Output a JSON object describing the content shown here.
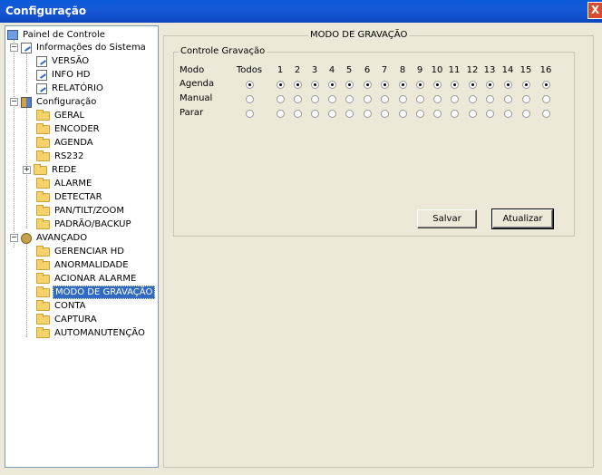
{
  "window": {
    "title": "Configuração",
    "close_label": "X"
  },
  "tree": {
    "root": "Painel de Controle",
    "info_sistema": "Informações do Sistema",
    "versao": "VERSÃO",
    "info_hd": "INFO HD",
    "relatorio": "RELATÓRIO",
    "configuracao": "Configuração",
    "geral": "GERAL",
    "encoder": "ENCODER",
    "agenda": "AGENDA",
    "rs232": "RS232",
    "rede": "REDE",
    "alarme": "ALARME",
    "detectar": "DETECTAR",
    "pantiltzoom": "PAN/TILT/ZOOM",
    "padrao_backup": "PADRÃO/BACKUP",
    "avancado": "AVANÇADO",
    "gerenciar_hd": "GERENCIAR HD",
    "anormalidade": "ANORMALIDADE",
    "acionar_alarme": "ACIONAR ALARME",
    "modo_gravacao": "MODO DE GRAVAÇÃO",
    "conta": "CONTA",
    "captura": "CAPTURA",
    "automanutencao": "AUTOMANUTENÇÃO"
  },
  "main": {
    "title": "MODO DE GRAVAÇÃO",
    "group_title": "Controle Gravação",
    "mode_header": "Modo",
    "all_header": "Todos",
    "channels": [
      "1",
      "2",
      "3",
      "4",
      "5",
      "6",
      "7",
      "8",
      "9",
      "10",
      "11",
      "12",
      "13",
      "14",
      "15",
      "16"
    ],
    "rows": [
      {
        "label": "Agenda",
        "selected": true
      },
      {
        "label": "Manual",
        "selected": false
      },
      {
        "label": "Parar",
        "selected": false
      }
    ],
    "save_label": "Salvar",
    "refresh_label": "Atualizar"
  }
}
